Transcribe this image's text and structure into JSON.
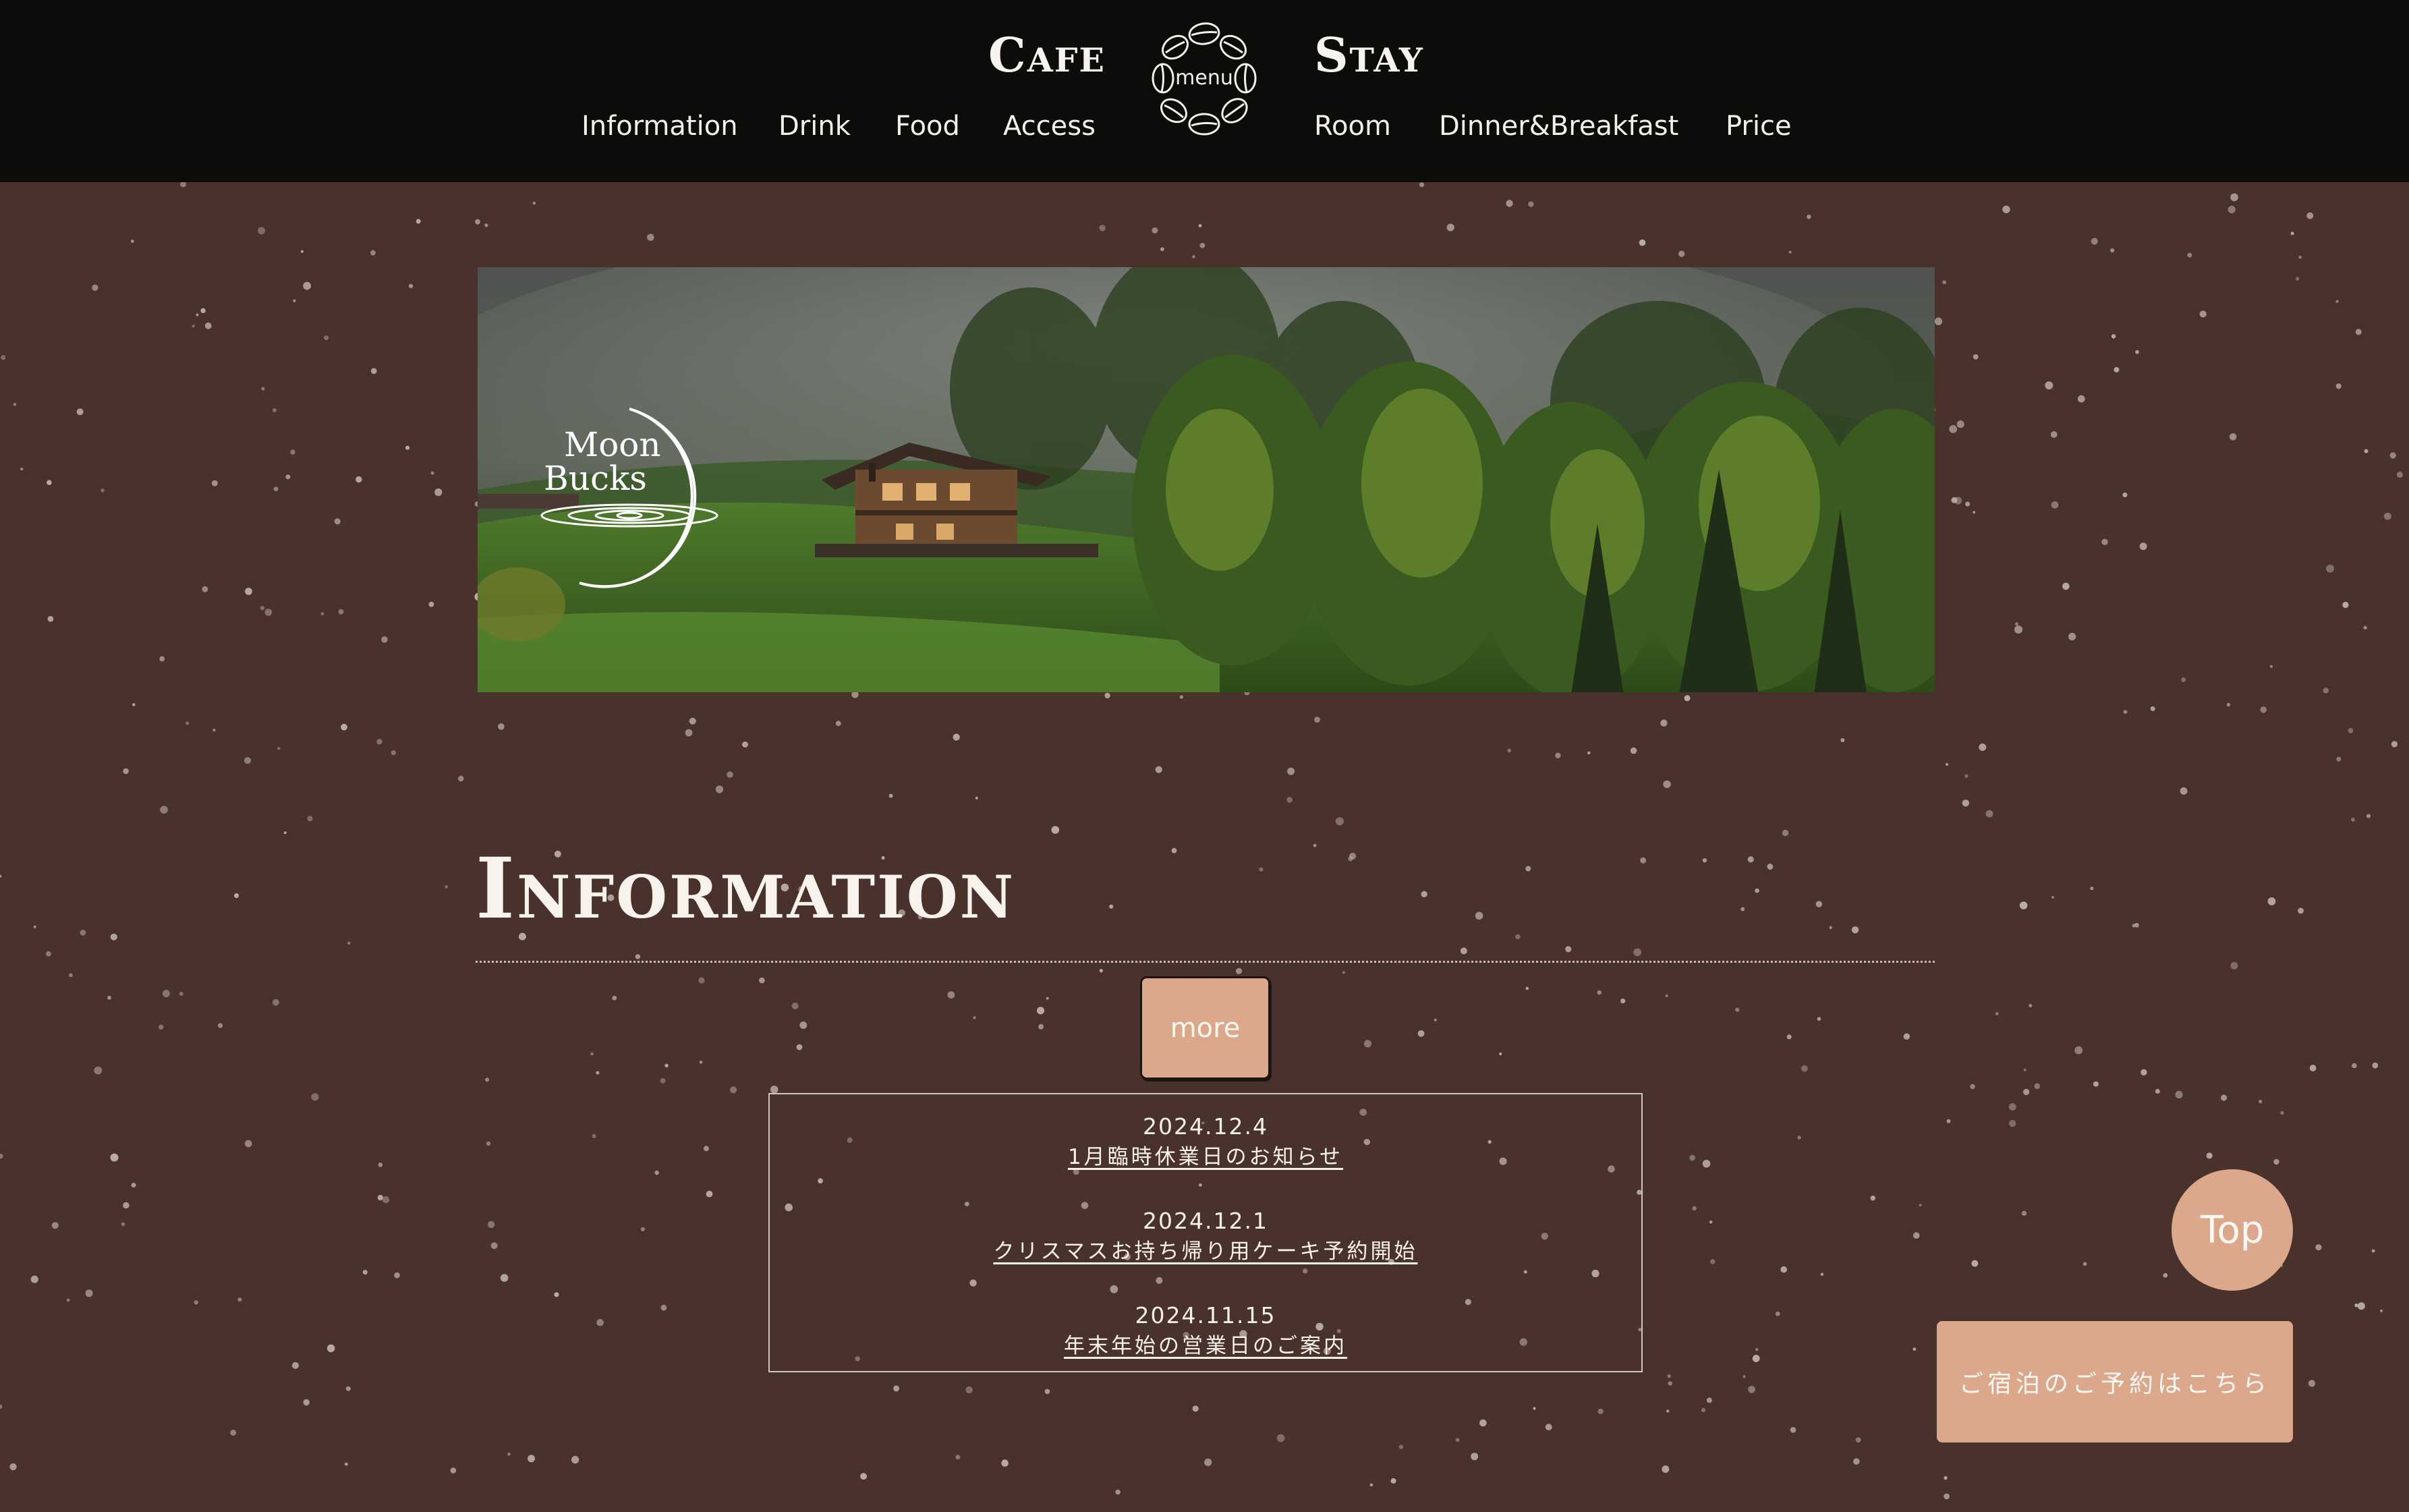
{
  "header": {
    "cafe_title": "Cafe",
    "stay_title": "Stay",
    "menu_logo_text": "menu",
    "cafe_nav": [
      "Information",
      "Drink",
      "Food",
      "Access"
    ],
    "stay_nav": [
      "Room",
      "Dinner&Breakfast",
      "Price"
    ]
  },
  "hero": {
    "logo_line1": "Moon",
    "logo_line2": "Bucks"
  },
  "information": {
    "title": "Information",
    "more_label": "more",
    "news": [
      {
        "date": "2024.12.4",
        "title": "1月臨時休業日のお知らせ"
      },
      {
        "date": "2024.12.1",
        "title": "クリスマスお持ち帰り用ケーキ予約開始"
      },
      {
        "date": "2024.11.15",
        "title": "年末年始の営業日のご案内"
      }
    ]
  },
  "floating": {
    "top_label": "Top",
    "reserve_label": "ご宿泊のご予約はこちら"
  },
  "colors": {
    "page_bg": "#4a322c",
    "header_bg": "#0c0c0b",
    "accent": "#dba88c"
  }
}
